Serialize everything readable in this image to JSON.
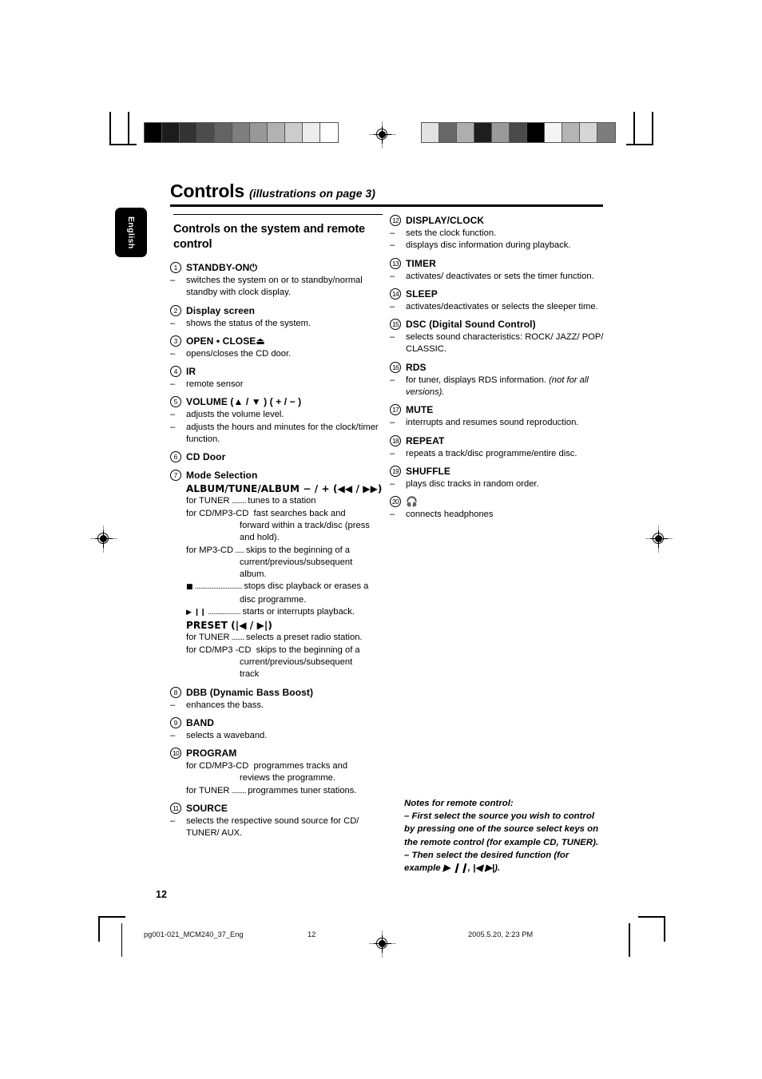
{
  "print_marks": {
    "gray_strip_left": [
      "#000000",
      "#1c1c1c",
      "#333333",
      "#4c4c4c",
      "#646464",
      "#7e7e7e",
      "#989898",
      "#b2b2b2",
      "#cccccc",
      "#ededed",
      "#ffffff"
    ],
    "gray_strip_right": [
      "#e2e2e2",
      "#676767",
      "#aeaeae",
      "#1e1e1e",
      "#9a9a9a",
      "#4a4a4a",
      "#000000",
      "#f4f4f4",
      "#b4b4b4",
      "#d6d6d6",
      "#7d7d7d"
    ]
  },
  "language_tab": {
    "label": "English"
  },
  "header": {
    "title": "Controls",
    "subtitle": "(illustrations on page 3)"
  },
  "left_column": {
    "section_heading": "Controls on the system and remote control",
    "entries": [
      {
        "num": "1",
        "title": "STANDBY-ON",
        "title_symbol": "⏻",
        "lines": [
          {
            "type": "dash",
            "text": "switches the system on or to standby/normal standby with clock display."
          }
        ]
      },
      {
        "num": "2",
        "title": "Display screen",
        "lines": [
          {
            "type": "dash",
            "text": "shows the status of the system."
          }
        ]
      },
      {
        "num": "3",
        "title": "OPEN • CLOSE",
        "title_symbol": "⏏",
        "lines": [
          {
            "type": "dash",
            "text": "opens/closes the CD door."
          }
        ]
      },
      {
        "num": "4",
        "title": "IR",
        "lines": [
          {
            "type": "dash",
            "text": "remote sensor"
          }
        ]
      },
      {
        "num": "5",
        "title": "VOLUME (▲ / ▼ ) ( + / − )",
        "lines": [
          {
            "type": "dash",
            "text": "adjusts the volume level."
          },
          {
            "type": "dash",
            "text": "adjusts the hours and minutes for the clock/timer function."
          }
        ]
      },
      {
        "num": "6",
        "title": "CD Door",
        "lines": []
      },
      {
        "num": "7",
        "title": "Mode Selection",
        "subtitle": "ALBUM/TUNE/ALBUM − / +  (◀◀ / ▶▶)",
        "rows": [
          {
            "label": "for TUNER",
            "leader": "........",
            "text": "tunes to a station"
          },
          {
            "label": "for CD/MP3-CD",
            "leader": "",
            "text": "fast searches back and"
          },
          {
            "indent": true,
            "text": "forward within a track/disc (press"
          },
          {
            "indent": true,
            "text": "and hold)."
          },
          {
            "label": "for MP3-CD",
            "leader": ".....",
            "text": "skips to the beginning of a"
          },
          {
            "indent": true,
            "text": "current/previous/subsequent"
          },
          {
            "indent": true,
            "text": "album."
          },
          {
            "symbol": "■",
            "leader": "..........................",
            "text": "stops disc playback or erases a"
          },
          {
            "indent": true,
            "text": "disc programme."
          },
          {
            "symbol": "▶ ❙❙",
            "leader": "..................",
            "text": "starts or interrupts playback."
          }
        ],
        "subtitle2": "PRESET (|◀ / ▶|)",
        "rows2": [
          {
            "label": "for TUNER",
            "leader": ".......",
            "text": "selects a preset radio station."
          },
          {
            "label": "for CD/MP3 -CD",
            "leader": "",
            "text": "skips to the beginning of a"
          },
          {
            "indent": true,
            "text": "current/previous/subsequent"
          },
          {
            "indent": true,
            "text": "track"
          }
        ]
      },
      {
        "num": "8",
        "title": "DBB (Dynamic Bass Boost)",
        "lines": [
          {
            "type": "dash",
            "text": "enhances the bass."
          }
        ]
      },
      {
        "num": "9",
        "title": "BAND",
        "lines": [
          {
            "type": "dash",
            "text": "selects a waveband."
          }
        ]
      },
      {
        "num": "10",
        "title": "PROGRAM",
        "rows": [
          {
            "label": "for CD/MP3-CD",
            "leader": "",
            "text": "programmes tracks and"
          },
          {
            "indent": true,
            "text": "reviews the programme."
          },
          {
            "label": "for TUNER",
            "leader": "........",
            "text": "programmes tuner stations."
          }
        ]
      },
      {
        "num": "11",
        "title": "SOURCE",
        "lines": [
          {
            "type": "dash",
            "text": "selects the respective sound source for CD/ TUNER/ AUX."
          }
        ]
      }
    ]
  },
  "right_column": {
    "entries": [
      {
        "num": "12",
        "title": "DISPLAY/CLOCK",
        "lines": [
          {
            "type": "dash",
            "text": "sets the clock function."
          },
          {
            "type": "dash",
            "text": "displays disc information during playback."
          }
        ]
      },
      {
        "num": "13",
        "title": "TIMER",
        "lines": [
          {
            "type": "dash",
            "text": "activates/ deactivates or sets the timer function."
          }
        ]
      },
      {
        "num": "14",
        "title": "SLEEP",
        "lines": [
          {
            "type": "dash",
            "text": "activates/deactivates or selects the sleeper time."
          }
        ]
      },
      {
        "num": "15",
        "title": "DSC (Digital Sound Control)",
        "lines": [
          {
            "type": "dash",
            "text": "selects sound characteristics: ROCK/ JAZZ/ POP/ CLASSIC."
          }
        ]
      },
      {
        "num": "16",
        "title": "RDS",
        "lines": [
          {
            "type": "dash",
            "text": "for tuner, displays RDS information. ",
            "italic_tail": "(not for all versions)."
          }
        ]
      },
      {
        "num": "17",
        "title": "MUTE",
        "lines": [
          {
            "type": "dash",
            "text": "interrupts and resumes sound reproduction."
          }
        ]
      },
      {
        "num": "18",
        "title": "REPEAT",
        "lines": [
          {
            "type": "dash",
            "text": "repeats a track/disc programme/entire disc."
          }
        ]
      },
      {
        "num": "19",
        "title": "SHUFFLE",
        "lines": [
          {
            "type": "dash",
            "text": "plays disc tracks in random order."
          }
        ]
      },
      {
        "num": "20",
        "title": "",
        "title_symbol": "🎧",
        "lines": [
          {
            "type": "dash",
            "text": "connects headphones"
          }
        ]
      }
    ]
  },
  "notes": {
    "heading": "Notes for remote control:",
    "item1": "–  First select the source you wish to control by pressing one of the source select keys on the remote control (for example CD, TUNER).",
    "item2": "–  Then select the desired function (for example ▶ ❙❙,   |◀ ▶|)."
  },
  "page_number": "12",
  "footer": {
    "file": "pg001-021_MCM240_37_Eng",
    "page": "12",
    "date": "2005.5.20, 2:23 PM"
  }
}
